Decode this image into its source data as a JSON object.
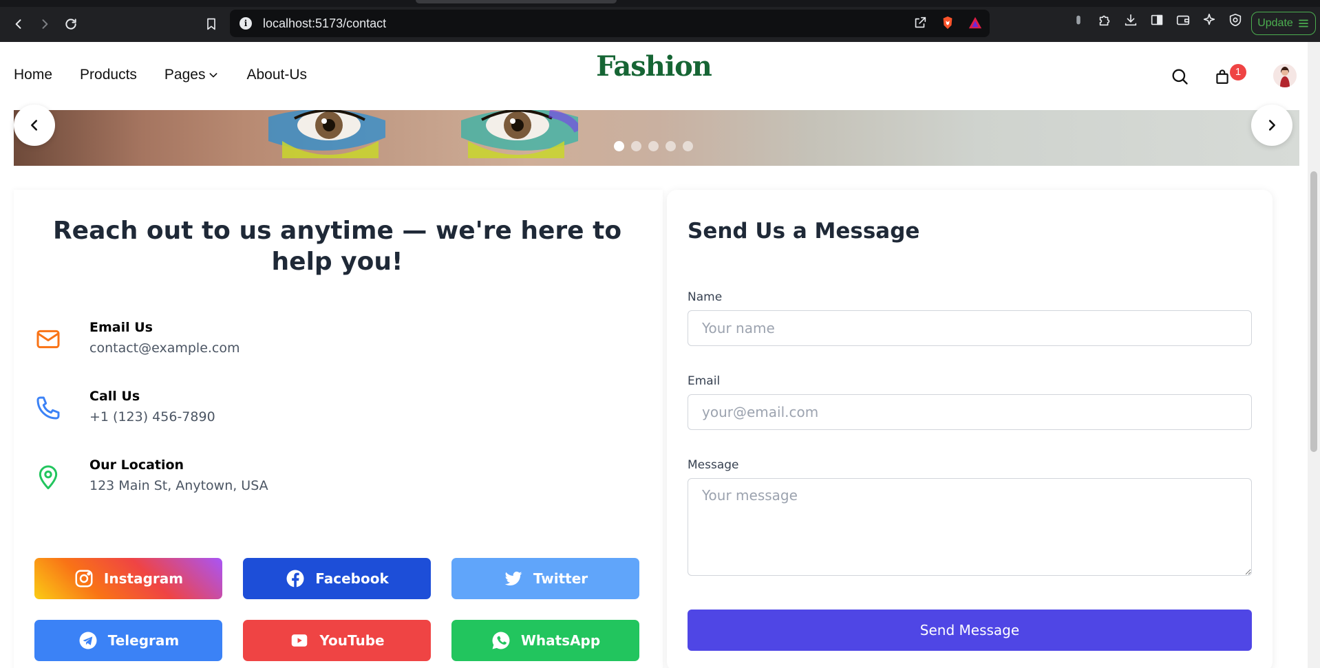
{
  "browser": {
    "url": "localhost:5173/contact",
    "update_label": "Update"
  },
  "header": {
    "nav": [
      "Home",
      "Products",
      "Pages",
      "About-Us"
    ],
    "brand": "Fashion",
    "cart_count": "1"
  },
  "hero": {
    "slides_total": 5,
    "active_slide": 1
  },
  "contact": {
    "headline": "Reach out to us anytime — we're here to help you!",
    "items": [
      {
        "title": "Email Us",
        "value": "contact@example.com",
        "icon": "mail-icon",
        "color": "#f97316"
      },
      {
        "title": "Call Us",
        "value": "+1 (123) 456-7890",
        "icon": "phone-icon",
        "color": "#3b82f6"
      },
      {
        "title": "Our Location",
        "value": "123 Main St, Anytown, USA",
        "icon": "map-pin-icon",
        "color": "#22c55e"
      }
    ],
    "socials": [
      {
        "label": "Instagram",
        "icon": "instagram-icon"
      },
      {
        "label": "Facebook",
        "icon": "facebook-icon"
      },
      {
        "label": "Twitter",
        "icon": "twitter-icon"
      },
      {
        "label": "Telegram",
        "icon": "telegram-icon"
      },
      {
        "label": "YouTube",
        "icon": "youtube-icon"
      },
      {
        "label": "WhatsApp",
        "icon": "whatsapp-icon"
      }
    ]
  },
  "form": {
    "title": "Send Us a Message",
    "name_label": "Name",
    "name_placeholder": "Your name",
    "email_label": "Email",
    "email_placeholder": "your@email.com",
    "message_label": "Message",
    "message_placeholder": "Your message",
    "submit_label": "Send Message"
  },
  "colors": {
    "brand": "#166534",
    "primary_button": "#4f46e5",
    "badge": "#ef4444"
  }
}
